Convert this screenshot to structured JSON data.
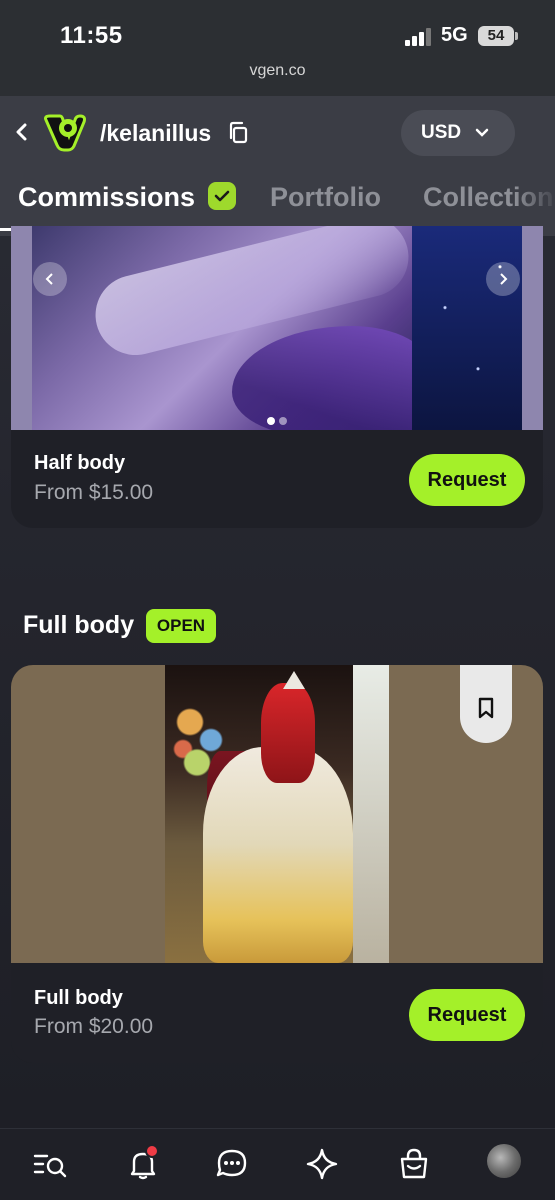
{
  "status_bar": {
    "time": "11:55",
    "network": "5G",
    "battery": "54"
  },
  "browser": {
    "url": "vgen.co"
  },
  "header": {
    "username": "/kelanillus",
    "currency": "USD",
    "tabs": [
      {
        "label": "Commissions",
        "active": true
      },
      {
        "label": "Portfolio",
        "active": false
      },
      {
        "label": "Collection",
        "active": false
      }
    ]
  },
  "commissions": [
    {
      "title": "Half body",
      "price": "From $15.00",
      "button": "Request",
      "carousel_page": 1,
      "carousel_total": 2
    },
    {
      "title": "Full body",
      "price": "From $20.00",
      "button": "Request"
    }
  ],
  "section": {
    "title": "Full body",
    "badge": "OPEN"
  },
  "bottom_nav": {
    "icons": [
      "browse-search-icon",
      "bell-icon",
      "chat-icon",
      "sparkle-icon",
      "shopping-bag-icon",
      "avatar"
    ],
    "notification": true
  },
  "colors": {
    "accent": "#a4f029",
    "background": "#24252d",
    "card": "#1f2027",
    "notification": "#ee3b45"
  }
}
